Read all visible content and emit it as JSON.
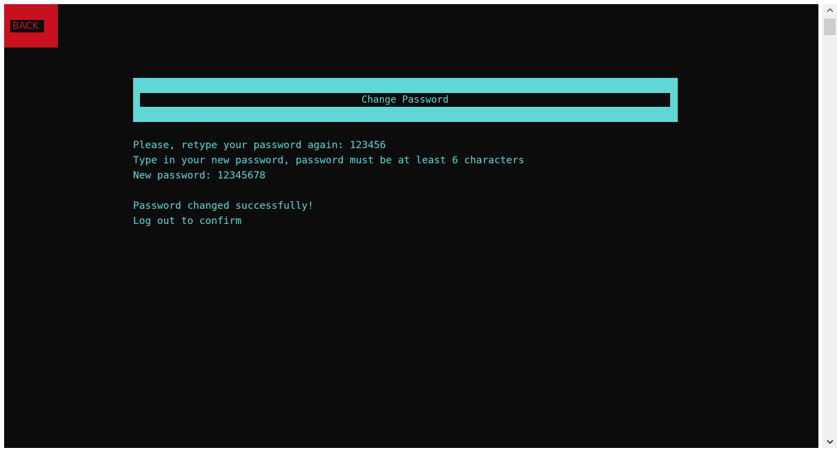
{
  "back_button": {
    "label": "BACK"
  },
  "header": {
    "title": "Change Password"
  },
  "console_lines": [
    "Please, retype your password again: 123456",
    "Type in your new password, password must be at least 6 characters",
    "New password: 12345678",
    "",
    "Password changed successfully!",
    "Log out to confirm"
  ],
  "colors": {
    "console_bg": "#0c0c0c",
    "accent_cyan": "#61d6d6",
    "back_red": "#c8111f"
  },
  "scrollbar": {
    "up_icon": "chevron-up-icon",
    "down_icon": "chevron-down-icon"
  }
}
